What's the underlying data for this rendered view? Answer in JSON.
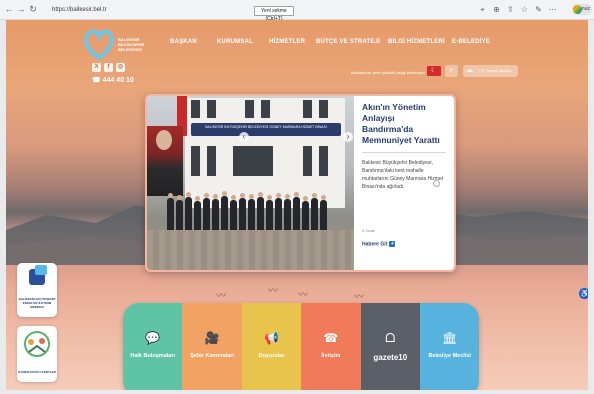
{
  "browser": {
    "url": "https://balikesir.bel.tr",
    "tooltip": "Yeni sekme (Ctrl+T)",
    "profile": "Sonuz"
  },
  "header": {
    "logo_text": "BALIKESİR BÜYÜKŞEHİR BELEDİYESİ",
    "nav": [
      "BAŞKAN",
      "KURUMSAL",
      "HİZMETLER",
      "BÜTÇE VE STRATEJİ",
      "BİLGİ HİZMETLERİ",
      "E-BELEDİYE"
    ],
    "phone": "444 40 10",
    "social": [
      {
        "icon": "x-icon",
        "glyph": "X"
      },
      {
        "icon": "facebook-icon",
        "glyph": "f"
      },
      {
        "icon": "instagram-icon",
        "glyph": "◎"
      }
    ],
    "weather_notice": "Balıkesir'de yarın şiddetli yağış bekleniyor",
    "weather_pill": "7°C Parçalı Bulutlu"
  },
  "slider": {
    "photo_banner": "BALIKESİR BÜYÜKŞEHİR BELEDİYESİ GÜNEY MARMARA HİZMET BİNASI",
    "title": "Akın'ın Yönetim Anlayışı Bandırma'da Memnuniyet Yarattı",
    "body": "Balıkesir Büyükşehir Belediyesi, Bandırma'daki kent mahalle muhtarlarını Güney Marmara Hizmet Binası'nda ağırladı.",
    "date": "9 Ocak",
    "more": "Habere Git"
  },
  "side_tiles": [
    {
      "label": "BALIKESİR BÜYÜKŞEHİR ENGELSİZ İLETİŞİM MERKEZİ"
    },
    {
      "label": "KARESİ DOSTU KENTLER"
    }
  ],
  "quick_links": [
    {
      "label": "Halk Buluşmaları",
      "icon": "chat-icon",
      "glyph": "💬",
      "color": "#5ec4a3"
    },
    {
      "label": "Şehir Kameraları",
      "icon": "camera-icon",
      "glyph": "🎥",
      "color": "#f2a263"
    },
    {
      "label": "Duyurular",
      "icon": "megaphone-icon",
      "glyph": "📢",
      "color": "#e9c44d"
    },
    {
      "label": "İletişim",
      "icon": "phone-icon",
      "glyph": "☎",
      "color": "#f07a5a"
    },
    {
      "label": "gazete10",
      "icon": "gazete10-logo-icon",
      "glyph": "ᗝ",
      "color": "#5a5f68"
    },
    {
      "label": "Belediye Meclisi",
      "icon": "building-icon",
      "glyph": "🏛",
      "color": "#57b3dd"
    }
  ]
}
